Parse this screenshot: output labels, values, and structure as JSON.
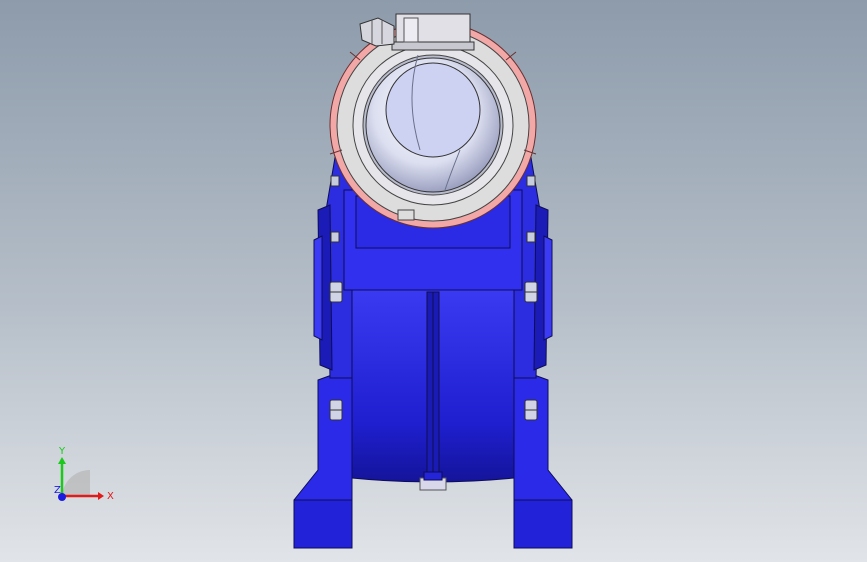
{
  "viewport": {
    "background_top": "#8d9bab",
    "background_bottom": "#e1e4e8"
  },
  "model": {
    "body_color": "#2323e6",
    "ring_color": "#f2a8a8",
    "bore_color": "#c9cff2"
  },
  "triad": {
    "x_label": "X",
    "y_label": "Y",
    "z_label": "Z",
    "x_color": "#e01b1b",
    "y_color": "#1bc81b",
    "z_color": "#1b1be0"
  }
}
